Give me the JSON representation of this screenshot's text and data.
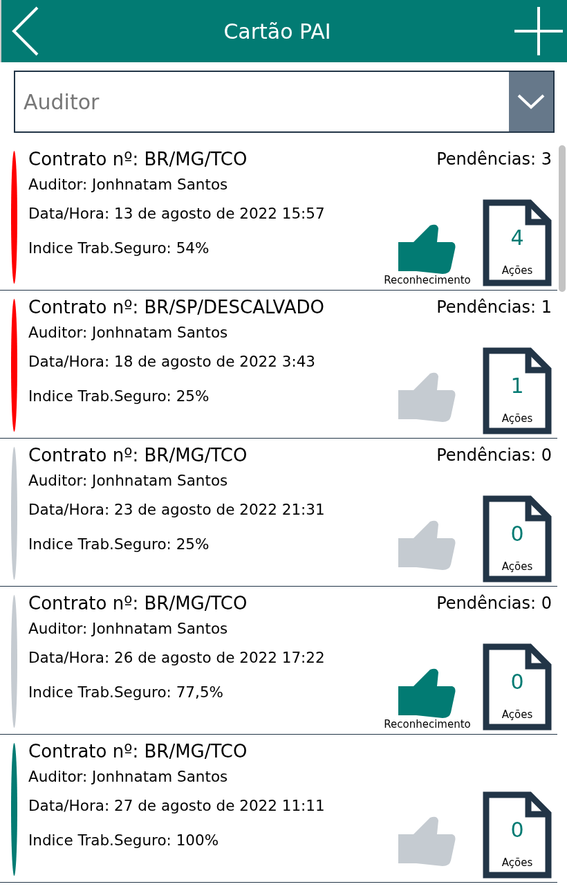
{
  "header": {
    "title": "Cartão PAI"
  },
  "filter": {
    "placeholder": "Auditor"
  },
  "cards": [
    {
      "contract": "Contrato nº: BR/MG/TCO",
      "auditor": "Auditor: Jonhnatam Santos",
      "datetime": "Data/Hora: 13 de agosto de 2022 15:57",
      "index": "Indice Trab.Seguro: 54%",
      "pending": "Pendências: 3",
      "color": "#ff0000",
      "recognized": true,
      "recognition_label": "Reconhecimento",
      "actions_count": "4",
      "actions_label": "Ações"
    },
    {
      "contract": "Contrato nº: BR/SP/DESCALVADO",
      "auditor": "Auditor: Jonhnatam Santos",
      "datetime": "Data/Hora: 18 de agosto de 2022 3:43",
      "index": "Indice Trab.Seguro: 25%",
      "pending": "Pendências: 1",
      "color": "#ff0000",
      "recognized": false,
      "actions_count": "1",
      "actions_label": "Ações"
    },
    {
      "contract": "Contrato nº: BR/MG/TCO",
      "auditor": "Auditor: Jonhnatam Santos",
      "datetime": "Data/Hora: 23 de agosto de 2022 21:31",
      "index": "Indice Trab.Seguro: 25%",
      "pending": "Pendências: 0",
      "color": "#c5cbd1",
      "recognized": false,
      "actions_count": "0",
      "actions_label": "Ações"
    },
    {
      "contract": "Contrato nº: BR/MG/TCO",
      "auditor": "Auditor: Jonhnatam Santos",
      "datetime": "Data/Hora: 26 de agosto de 2022 17:22",
      "index": "Indice Trab.Seguro: 77,5%",
      "pending": "Pendências: 0",
      "color": "#c5cbd1",
      "recognized": true,
      "recognition_label": "Reconhecimento",
      "actions_count": "0",
      "actions_label": "Ações"
    },
    {
      "contract": "Contrato nº: BR/MG/TCO",
      "auditor": "Auditor: Jonhnatam Santos",
      "datetime": "Data/Hora: 27 de agosto de 2022 11:11",
      "index": "Indice Trab.Seguro: 100%",
      "color": "#027b73",
      "recognized": false,
      "actions_count": "0",
      "actions_label": "Ações"
    }
  ]
}
